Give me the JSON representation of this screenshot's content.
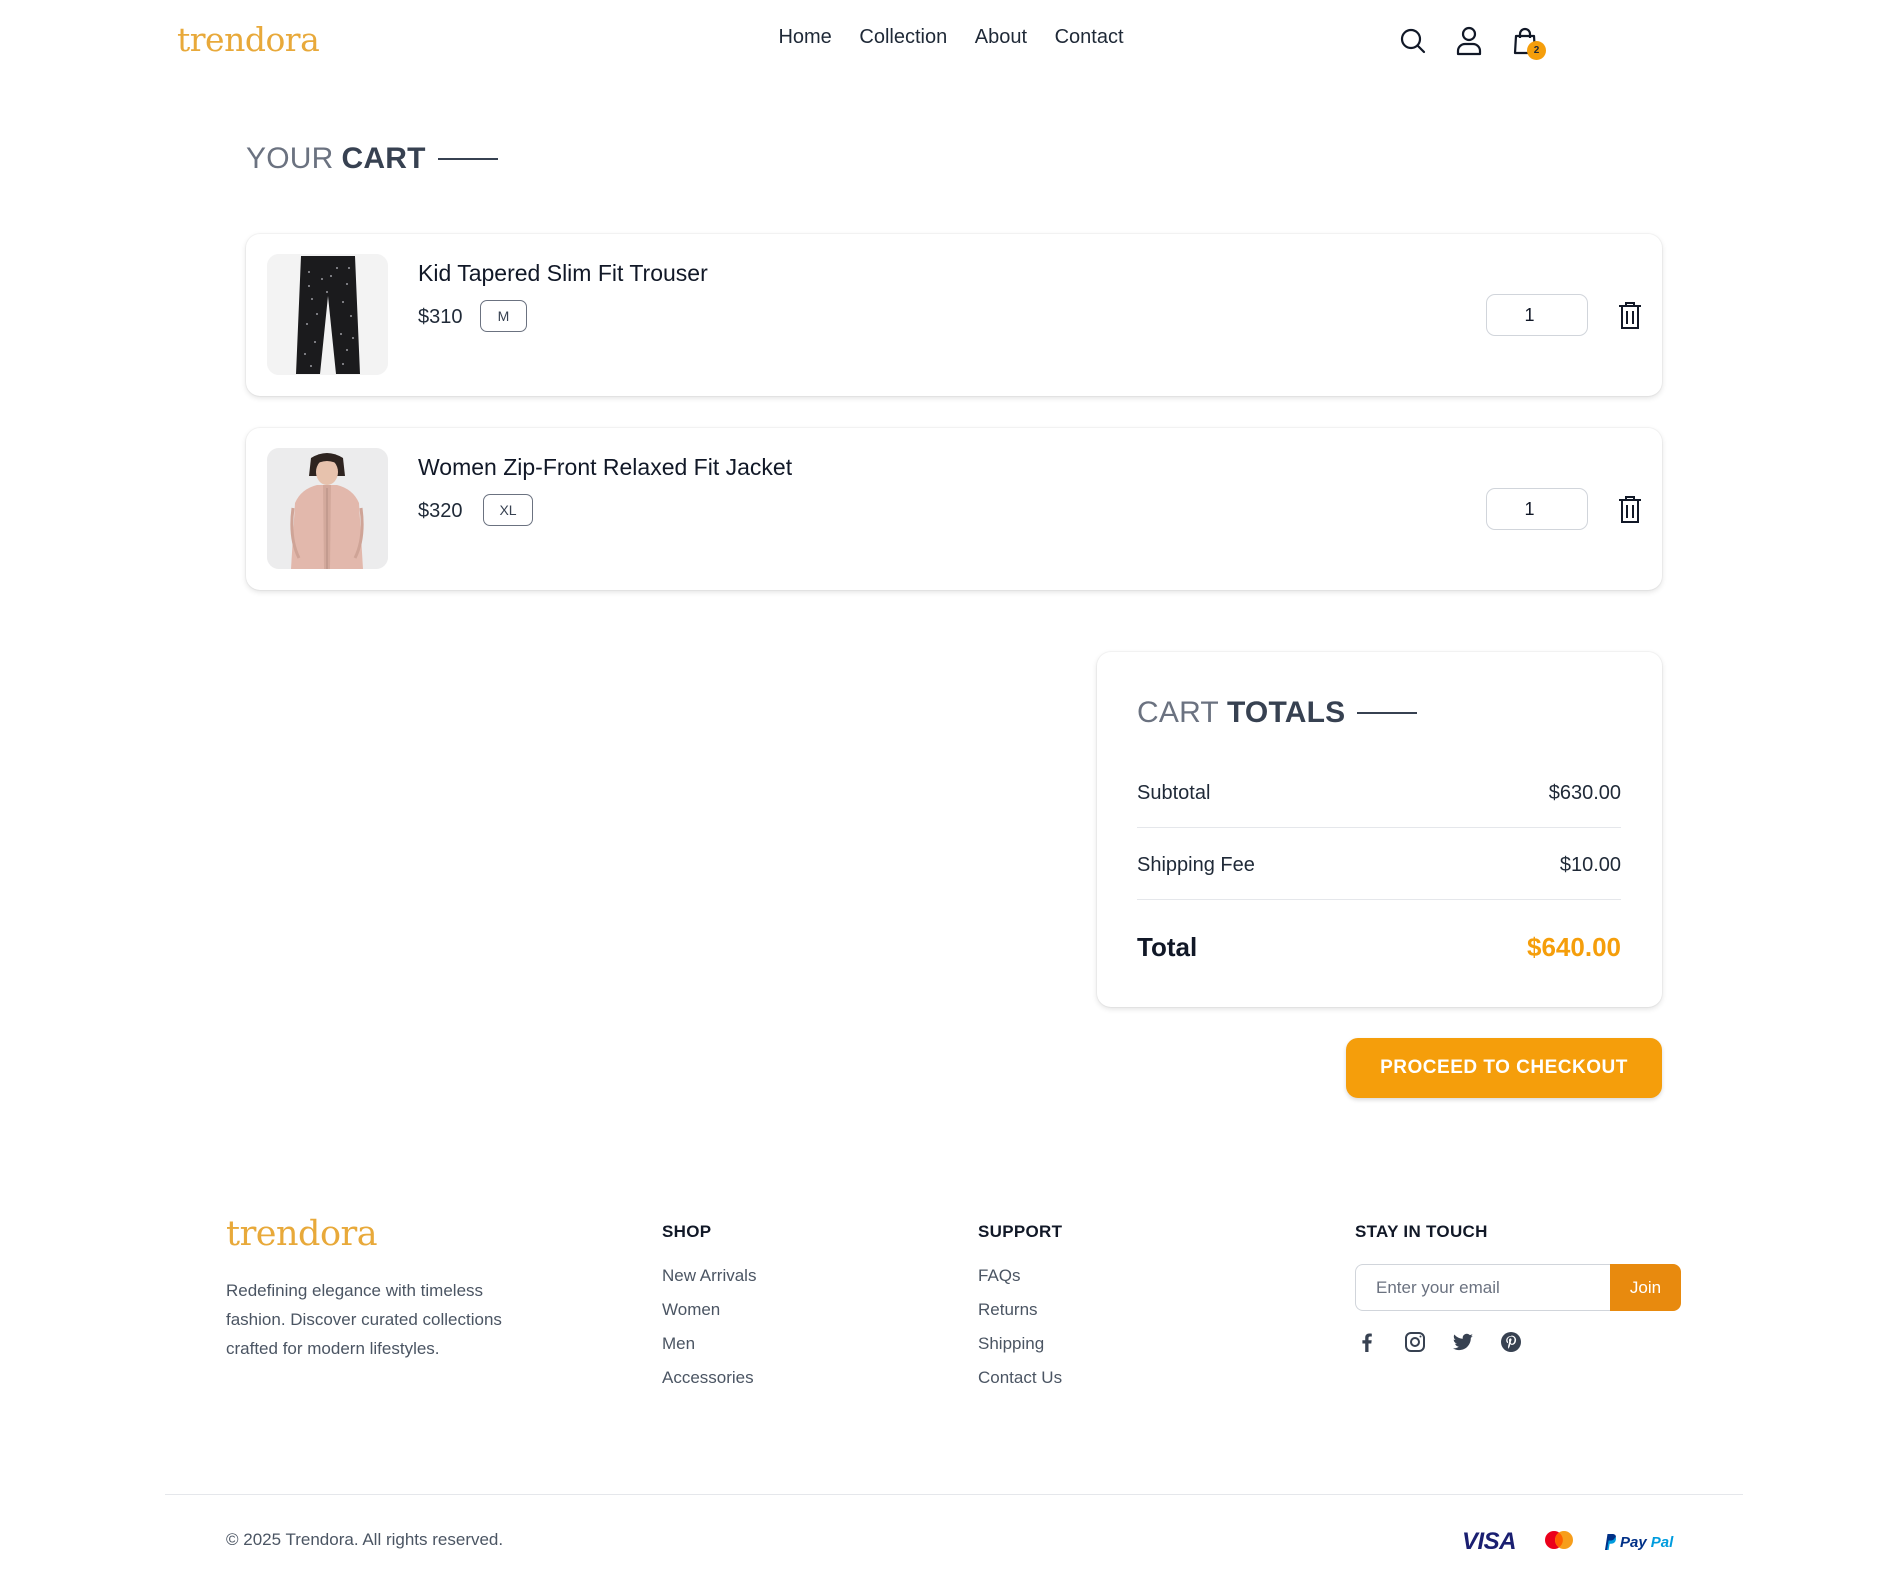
{
  "brand": {
    "name": "trendora"
  },
  "nav": {
    "items": [
      "Home",
      "Collection",
      "About",
      "Contact"
    ]
  },
  "header": {
    "cart_count": "2"
  },
  "cart": {
    "title_light": "YOUR",
    "title_bold": "CART",
    "items": [
      {
        "name": "Kid Tapered Slim Fit Trouser",
        "price": "$310",
        "size": "M",
        "quantity": "1"
      },
      {
        "name": "Women Zip-Front Relaxed Fit Jacket",
        "price": "$320",
        "size": "XL",
        "quantity": "1"
      }
    ]
  },
  "totals": {
    "title_light": "CART",
    "title_bold": "TOTALS",
    "subtotal_label": "Subtotal",
    "subtotal_value": "$630.00",
    "shipping_label": "Shipping Fee",
    "shipping_value": "$10.00",
    "total_label": "Total",
    "total_value": "$640.00",
    "accent_color": "#f59e0b"
  },
  "checkout": {
    "label": "PROCEED TO CHECKOUT"
  },
  "footer": {
    "description": "Redefining elegance with timeless fashion. Discover curated collections crafted for modern lifestyles.",
    "shop": {
      "heading": "SHOP",
      "links": [
        "New Arrivals",
        "Women",
        "Men",
        "Accessories"
      ]
    },
    "support": {
      "heading": "SUPPORT",
      "links": [
        "FAQs",
        "Returns",
        "Shipping",
        "Contact Us"
      ]
    },
    "touch": {
      "heading": "STAY IN TOUCH",
      "email_placeholder": "Enter your email",
      "join_label": "Join"
    },
    "socials": [
      "facebook-icon",
      "instagram-icon",
      "twitter-icon",
      "pinterest-icon"
    ],
    "copyright": "© 2025 Trendora. All rights reserved.",
    "payments": {
      "visa": "VISA",
      "paypal_1": "Pay",
      "paypal_2": "Pal"
    }
  }
}
